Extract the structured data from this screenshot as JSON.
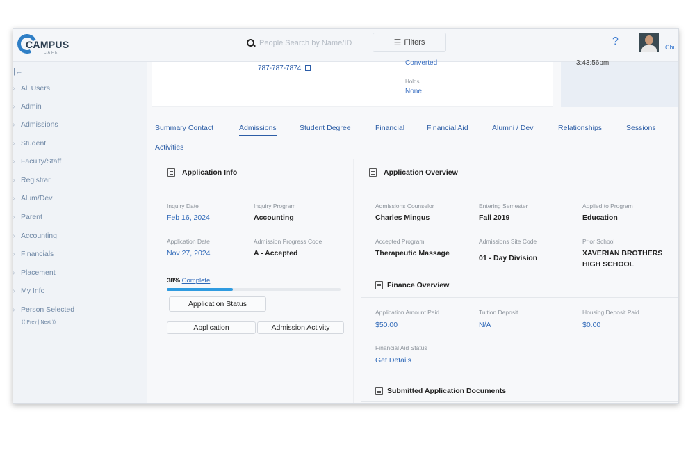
{
  "header": {
    "logo_text": "CAMPUS",
    "logo_sub": "CAFE",
    "search_placeholder": "People Search by Name/ID",
    "filters_label": "Filters",
    "help_label": "?",
    "user_name": "Chu"
  },
  "sidebar": {
    "collapse": "|←",
    "items": [
      {
        "label": "All Users"
      },
      {
        "label": "Admin"
      },
      {
        "label": "Admissions"
      },
      {
        "label": "Student"
      },
      {
        "label": "Faculty/Staff"
      },
      {
        "label": "Registrar"
      },
      {
        "label": "Alum/Dev"
      },
      {
        "label": "Parent"
      },
      {
        "label": "Accounting"
      },
      {
        "label": "Financials"
      },
      {
        "label": "Placement"
      },
      {
        "label": "My Info"
      },
      {
        "label": "Person Selected"
      }
    ],
    "nav": "⟨⟨ Prev | Next ⟩⟩"
  },
  "profile": {
    "phone": "787-787-7874",
    "status": "Converted",
    "holds_label": "Holds",
    "holds_value": "None",
    "time_value": "3:43:56pm"
  },
  "tabs": [
    "Summary Contact",
    "Admissions",
    "Student Degree",
    "Financial",
    "Financial Aid",
    "Alumni / Dev",
    "Relationships",
    "Sessions",
    "Activities"
  ],
  "application_info": {
    "title": "Application Info",
    "inquiry_date_label": "Inquiry Date",
    "inquiry_date": "Feb 16, 2024",
    "inquiry_program_label": "Inquiry Program",
    "inquiry_program": "Accounting",
    "application_date_label": "Application Date",
    "application_date": "Nov 27, 2024",
    "progress_code_label": "Admission Progress Code",
    "progress_code": "A - Accepted",
    "progress_pct": "38%",
    "progress_word": "Complete",
    "progress_value": 0.38,
    "status_button": "Application Status",
    "application_button": "Application",
    "activity_button": "Admission Activity"
  },
  "application_overview": {
    "title": "Application Overview",
    "counselor_label": "Admissions Counselor",
    "counselor": "Charles Mingus",
    "semester_label": "Entering Semester",
    "semester": "Fall 2019",
    "applied_program_label": "Applied to Program",
    "applied_program": "Education",
    "accepted_program_label": "Accepted Program",
    "accepted_program": "Therapeutic Massage",
    "site_code_label": "Admissions Site Code",
    "site_code": "01 - Day Division",
    "prior_school_label": "Prior School",
    "prior_school_line1": "XAVERIAN BROTHERS",
    "prior_school_line2": "HIGH SCHOOL"
  },
  "finance_overview": {
    "title": "Finance Overview",
    "amount_paid_label": "Application Amount Paid",
    "amount_paid": "$50.00",
    "tuition_deposit_label": "Tuition Deposit",
    "tuition_deposit": "N/A",
    "housing_deposit_label": "Housing Deposit Paid",
    "housing_deposit": "$0.00",
    "aid_status_label": "Financial Aid Status",
    "aid_status": "Get Details"
  },
  "documents": {
    "title": "Submitted Application Documents"
  }
}
